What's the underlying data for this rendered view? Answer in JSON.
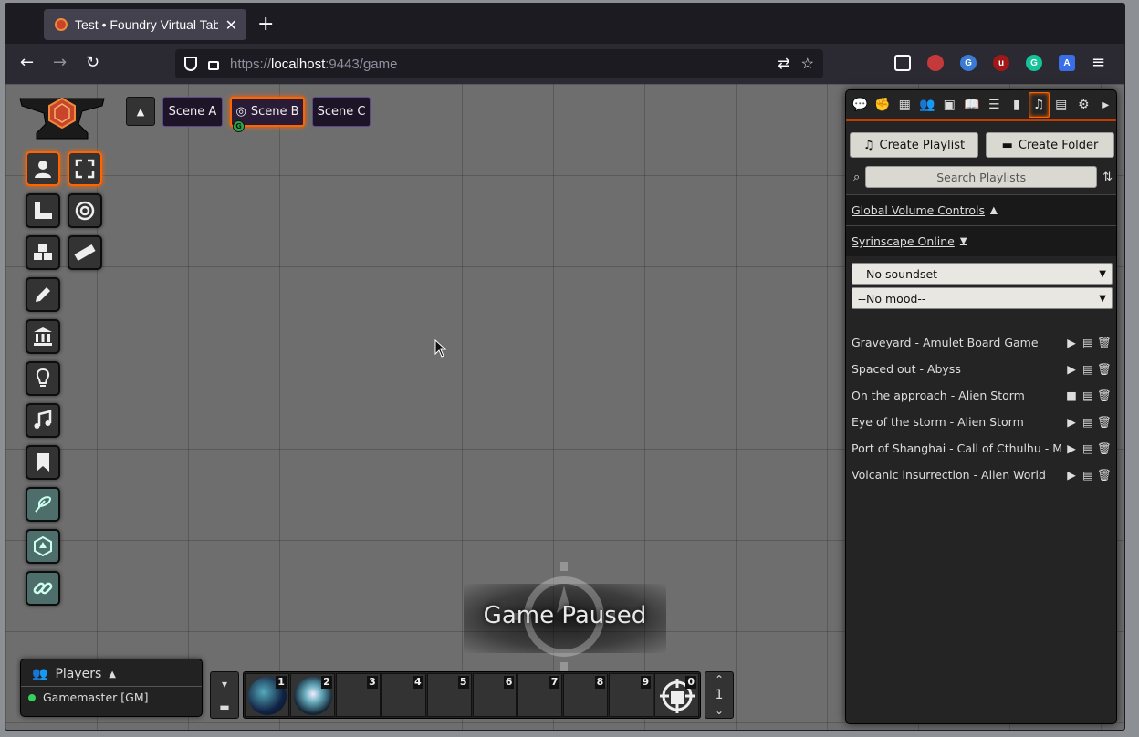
{
  "browser": {
    "tab_title": "Test • Foundry Virtual Tab",
    "url_prefix": "https://",
    "url_host": "localhost",
    "url_rest": ":9443/game"
  },
  "scenes": [
    {
      "label": "Scene A"
    },
    {
      "label": "Scene B",
      "active": true,
      "gm_badge": "G"
    },
    {
      "label": "Scene C"
    }
  ],
  "paused_text": "Game Paused",
  "players": {
    "header": "Players",
    "list": [
      {
        "name": "Gamemaster [GM]",
        "status_color": "#36d15a"
      }
    ]
  },
  "hotbar": {
    "slots": [
      "1",
      "2",
      "3",
      "4",
      "5",
      "6",
      "7",
      "8",
      "9",
      "0"
    ],
    "page": "1"
  },
  "sidebar": {
    "active_tab": "playlists",
    "create_playlist": "Create Playlist",
    "create_folder": "Create Folder",
    "search_placeholder": "Search Playlists",
    "global_volume": "Global Volume Controls",
    "syrinscape": "Syrinscape Online",
    "soundset_select": "--No soundset--",
    "mood_select": "--No mood--",
    "playlists": [
      {
        "name": "Graveyard - Amulet Board Game",
        "state": "stopped"
      },
      {
        "name": "Spaced out - Abyss",
        "state": "stopped"
      },
      {
        "name": "On the approach - Alien Storm",
        "state": "playing"
      },
      {
        "name": "Eye of the storm - Alien Storm",
        "state": "stopped"
      },
      {
        "name": "Port of Shanghai - Call of Cthulhu - M",
        "state": "stopped"
      },
      {
        "name": "Volcanic insurrection - Alien World",
        "state": "stopped"
      }
    ]
  },
  "colors": {
    "accent": "#ff6400",
    "sidebar_bg": "#242424",
    "scene_tab_bg": "#1e1428"
  }
}
